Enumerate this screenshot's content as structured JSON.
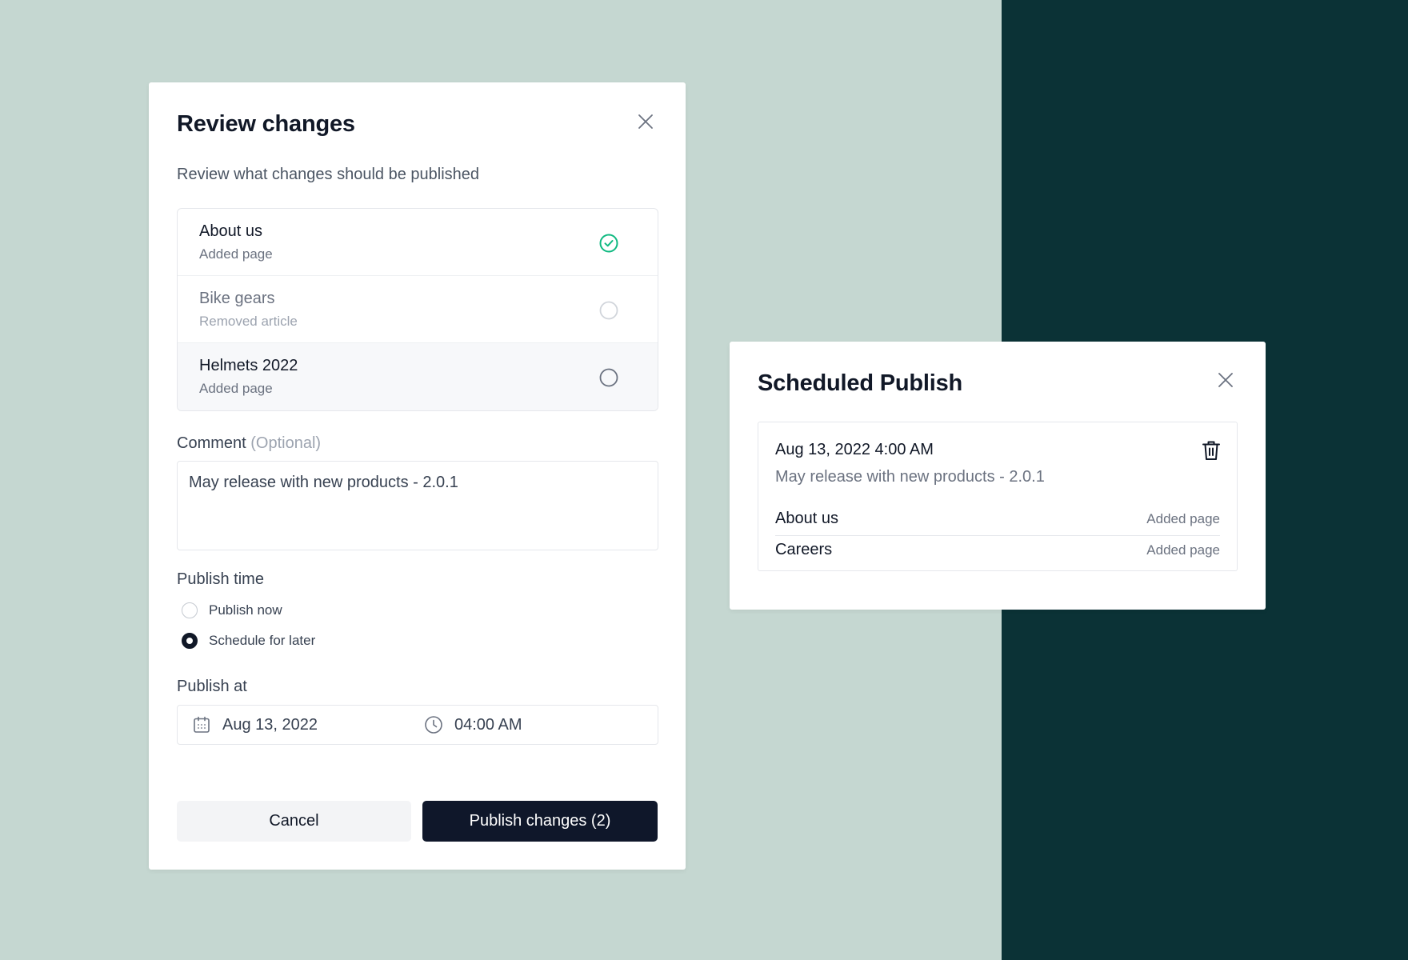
{
  "review": {
    "title": "Review changes",
    "subtitle": "Review what changes should be published",
    "items": [
      {
        "name": "About us",
        "type": "Added page",
        "checked": true
      },
      {
        "name": "Bike gears",
        "type": "Removed article",
        "checked": false
      },
      {
        "name": "Helmets 2022",
        "type": "Added page",
        "checked": false
      }
    ],
    "comment_label": "Comment",
    "comment_optional": "(Optional)",
    "comment_value": "May release with new products - 2.0.1",
    "publish_time_label": "Publish time",
    "options": [
      {
        "label": "Publish now",
        "selected": false
      },
      {
        "label": "Schedule for later",
        "selected": true
      }
    ],
    "publish_at_label": "Publish at",
    "date_value": "Aug 13, 2022",
    "time_value": "04:00 AM",
    "cancel_label": "Cancel",
    "publish_label": "Publish changes (2)"
  },
  "scheduled": {
    "title": "Scheduled Publish",
    "datetime": "Aug 13, 2022 4:00 AM",
    "comment": "May release with new products - 2.0.1",
    "items": [
      {
        "name": "About us",
        "type": "Added page"
      },
      {
        "name": "Careers",
        "type": "Added page"
      }
    ]
  },
  "icons": {
    "close": "close-icon",
    "check": "check-circle-icon",
    "calendar": "calendar-icon",
    "clock": "clock-icon",
    "trash": "trash-icon"
  },
  "colors": {
    "background_left": "#c5d7d1",
    "background_right": "#0b3236",
    "primary_button": "#0f172a",
    "check_green": "#10b981"
  }
}
